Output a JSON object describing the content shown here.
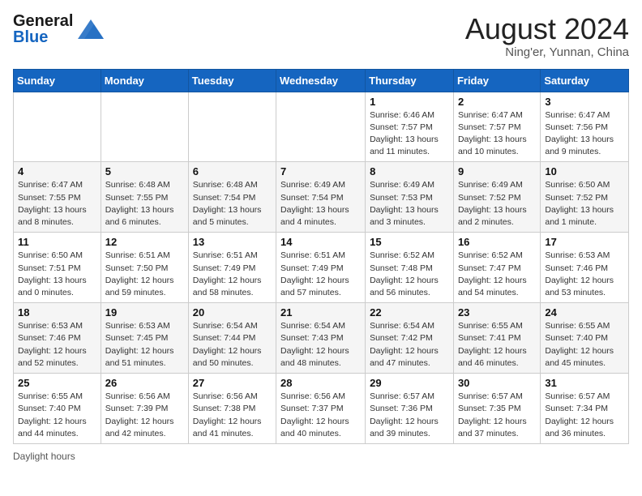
{
  "header": {
    "logo_line1": "General",
    "logo_line2": "Blue",
    "month_year": "August 2024",
    "location": "Ning'er, Yunnan, China"
  },
  "weekdays": [
    "Sunday",
    "Monday",
    "Tuesday",
    "Wednesday",
    "Thursday",
    "Friday",
    "Saturday"
  ],
  "footer": {
    "daylight_label": "Daylight hours"
  },
  "weeks": [
    [
      {
        "day": "",
        "sunrise": "",
        "sunset": "",
        "daylight": ""
      },
      {
        "day": "",
        "sunrise": "",
        "sunset": "",
        "daylight": ""
      },
      {
        "day": "",
        "sunrise": "",
        "sunset": "",
        "daylight": ""
      },
      {
        "day": "",
        "sunrise": "",
        "sunset": "",
        "daylight": ""
      },
      {
        "day": "1",
        "sunrise": "Sunrise: 6:46 AM",
        "sunset": "Sunset: 7:57 PM",
        "daylight": "Daylight: 13 hours and 11 minutes."
      },
      {
        "day": "2",
        "sunrise": "Sunrise: 6:47 AM",
        "sunset": "Sunset: 7:57 PM",
        "daylight": "Daylight: 13 hours and 10 minutes."
      },
      {
        "day": "3",
        "sunrise": "Sunrise: 6:47 AM",
        "sunset": "Sunset: 7:56 PM",
        "daylight": "Daylight: 13 hours and 9 minutes."
      }
    ],
    [
      {
        "day": "4",
        "sunrise": "Sunrise: 6:47 AM",
        "sunset": "Sunset: 7:55 PM",
        "daylight": "Daylight: 13 hours and 8 minutes."
      },
      {
        "day": "5",
        "sunrise": "Sunrise: 6:48 AM",
        "sunset": "Sunset: 7:55 PM",
        "daylight": "Daylight: 13 hours and 6 minutes."
      },
      {
        "day": "6",
        "sunrise": "Sunrise: 6:48 AM",
        "sunset": "Sunset: 7:54 PM",
        "daylight": "Daylight: 13 hours and 5 minutes."
      },
      {
        "day": "7",
        "sunrise": "Sunrise: 6:49 AM",
        "sunset": "Sunset: 7:54 PM",
        "daylight": "Daylight: 13 hours and 4 minutes."
      },
      {
        "day": "8",
        "sunrise": "Sunrise: 6:49 AM",
        "sunset": "Sunset: 7:53 PM",
        "daylight": "Daylight: 13 hours and 3 minutes."
      },
      {
        "day": "9",
        "sunrise": "Sunrise: 6:49 AM",
        "sunset": "Sunset: 7:52 PM",
        "daylight": "Daylight: 13 hours and 2 minutes."
      },
      {
        "day": "10",
        "sunrise": "Sunrise: 6:50 AM",
        "sunset": "Sunset: 7:52 PM",
        "daylight": "Daylight: 13 hours and 1 minute."
      }
    ],
    [
      {
        "day": "11",
        "sunrise": "Sunrise: 6:50 AM",
        "sunset": "Sunset: 7:51 PM",
        "daylight": "Daylight: 13 hours and 0 minutes."
      },
      {
        "day": "12",
        "sunrise": "Sunrise: 6:51 AM",
        "sunset": "Sunset: 7:50 PM",
        "daylight": "Daylight: 12 hours and 59 minutes."
      },
      {
        "day": "13",
        "sunrise": "Sunrise: 6:51 AM",
        "sunset": "Sunset: 7:49 PM",
        "daylight": "Daylight: 12 hours and 58 minutes."
      },
      {
        "day": "14",
        "sunrise": "Sunrise: 6:51 AM",
        "sunset": "Sunset: 7:49 PM",
        "daylight": "Daylight: 12 hours and 57 minutes."
      },
      {
        "day": "15",
        "sunrise": "Sunrise: 6:52 AM",
        "sunset": "Sunset: 7:48 PM",
        "daylight": "Daylight: 12 hours and 56 minutes."
      },
      {
        "day": "16",
        "sunrise": "Sunrise: 6:52 AM",
        "sunset": "Sunset: 7:47 PM",
        "daylight": "Daylight: 12 hours and 54 minutes."
      },
      {
        "day": "17",
        "sunrise": "Sunrise: 6:53 AM",
        "sunset": "Sunset: 7:46 PM",
        "daylight": "Daylight: 12 hours and 53 minutes."
      }
    ],
    [
      {
        "day": "18",
        "sunrise": "Sunrise: 6:53 AM",
        "sunset": "Sunset: 7:46 PM",
        "daylight": "Daylight: 12 hours and 52 minutes."
      },
      {
        "day": "19",
        "sunrise": "Sunrise: 6:53 AM",
        "sunset": "Sunset: 7:45 PM",
        "daylight": "Daylight: 12 hours and 51 minutes."
      },
      {
        "day": "20",
        "sunrise": "Sunrise: 6:54 AM",
        "sunset": "Sunset: 7:44 PM",
        "daylight": "Daylight: 12 hours and 50 minutes."
      },
      {
        "day": "21",
        "sunrise": "Sunrise: 6:54 AM",
        "sunset": "Sunset: 7:43 PM",
        "daylight": "Daylight: 12 hours and 48 minutes."
      },
      {
        "day": "22",
        "sunrise": "Sunrise: 6:54 AM",
        "sunset": "Sunset: 7:42 PM",
        "daylight": "Daylight: 12 hours and 47 minutes."
      },
      {
        "day": "23",
        "sunrise": "Sunrise: 6:55 AM",
        "sunset": "Sunset: 7:41 PM",
        "daylight": "Daylight: 12 hours and 46 minutes."
      },
      {
        "day": "24",
        "sunrise": "Sunrise: 6:55 AM",
        "sunset": "Sunset: 7:40 PM",
        "daylight": "Daylight: 12 hours and 45 minutes."
      }
    ],
    [
      {
        "day": "25",
        "sunrise": "Sunrise: 6:55 AM",
        "sunset": "Sunset: 7:40 PM",
        "daylight": "Daylight: 12 hours and 44 minutes."
      },
      {
        "day": "26",
        "sunrise": "Sunrise: 6:56 AM",
        "sunset": "Sunset: 7:39 PM",
        "daylight": "Daylight: 12 hours and 42 minutes."
      },
      {
        "day": "27",
        "sunrise": "Sunrise: 6:56 AM",
        "sunset": "Sunset: 7:38 PM",
        "daylight": "Daylight: 12 hours and 41 minutes."
      },
      {
        "day": "28",
        "sunrise": "Sunrise: 6:56 AM",
        "sunset": "Sunset: 7:37 PM",
        "daylight": "Daylight: 12 hours and 40 minutes."
      },
      {
        "day": "29",
        "sunrise": "Sunrise: 6:57 AM",
        "sunset": "Sunset: 7:36 PM",
        "daylight": "Daylight: 12 hours and 39 minutes."
      },
      {
        "day": "30",
        "sunrise": "Sunrise: 6:57 AM",
        "sunset": "Sunset: 7:35 PM",
        "daylight": "Daylight: 12 hours and 37 minutes."
      },
      {
        "day": "31",
        "sunrise": "Sunrise: 6:57 AM",
        "sunset": "Sunset: 7:34 PM",
        "daylight": "Daylight: 12 hours and 36 minutes."
      }
    ]
  ]
}
